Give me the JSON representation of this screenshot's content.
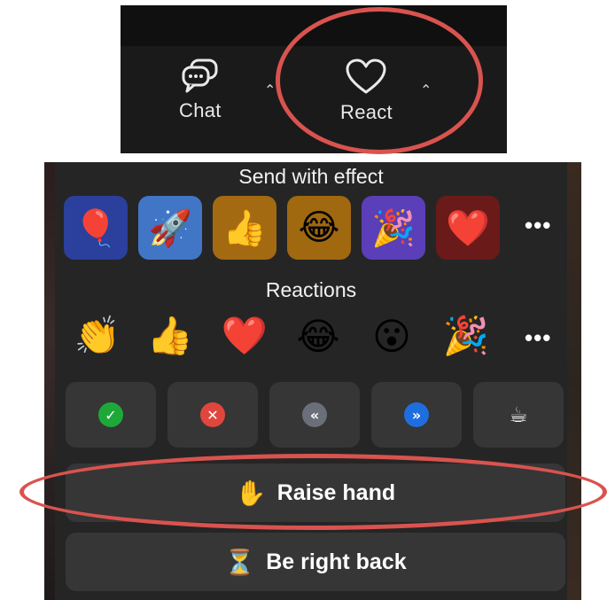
{
  "toolbar": {
    "chat": {
      "label": "Chat",
      "icon": "chat-bubbles-icon"
    },
    "react": {
      "label": "React",
      "icon": "heart-outline-icon"
    },
    "caret_glyph": "⌃"
  },
  "panel": {
    "send_with_effect": {
      "title": "Send with effect",
      "items": [
        {
          "icon": "balloon",
          "glyph": "🎈",
          "bg": "#2b3f9c"
        },
        {
          "icon": "rocket",
          "glyph": "🚀",
          "bg": "#4176c6"
        },
        {
          "icon": "thumbs-up",
          "glyph": "👍",
          "bg": "#a36a12"
        },
        {
          "icon": "tears-of-joy",
          "glyph": "😂",
          "bg": "#a0680f"
        },
        {
          "icon": "party-popper",
          "glyph": "🎉",
          "bg": "#5a3fb8"
        },
        {
          "icon": "red-heart",
          "glyph": "❤️",
          "bg": "#6b1a1a"
        }
      ],
      "more": "•••"
    },
    "reactions": {
      "title": "Reactions",
      "items": [
        {
          "icon": "clapping-hands",
          "glyph": "👏"
        },
        {
          "icon": "thumbs-up",
          "glyph": "👍"
        },
        {
          "icon": "red-heart",
          "glyph": "❤️"
        },
        {
          "icon": "tears-of-joy",
          "glyph": "😂"
        },
        {
          "icon": "surprised-face",
          "glyph": "😮"
        },
        {
          "icon": "party-popper",
          "glyph": "🎉"
        }
      ],
      "more": "•••"
    },
    "status": [
      {
        "icon": "yes-check",
        "glyph": "✓",
        "color": "#1fa83a"
      },
      {
        "icon": "no-x",
        "glyph": "✕",
        "color": "#e0463d"
      },
      {
        "icon": "slower-rewind",
        "glyph": "«",
        "color": "#6b6f7a"
      },
      {
        "icon": "faster-forward",
        "glyph": "»",
        "color": "#1f6ee0"
      },
      {
        "icon": "coffee-cup",
        "glyph": "☕",
        "color": "#4a4a4a"
      }
    ],
    "raise_hand": {
      "label": "Raise hand",
      "glyph": "✋"
    },
    "be_right_back": {
      "label": "Be right back",
      "glyph": "⏳"
    }
  },
  "colors": {
    "annotation": "#d9534f",
    "panel_bg": "#252525",
    "button_bg": "#363636"
  }
}
